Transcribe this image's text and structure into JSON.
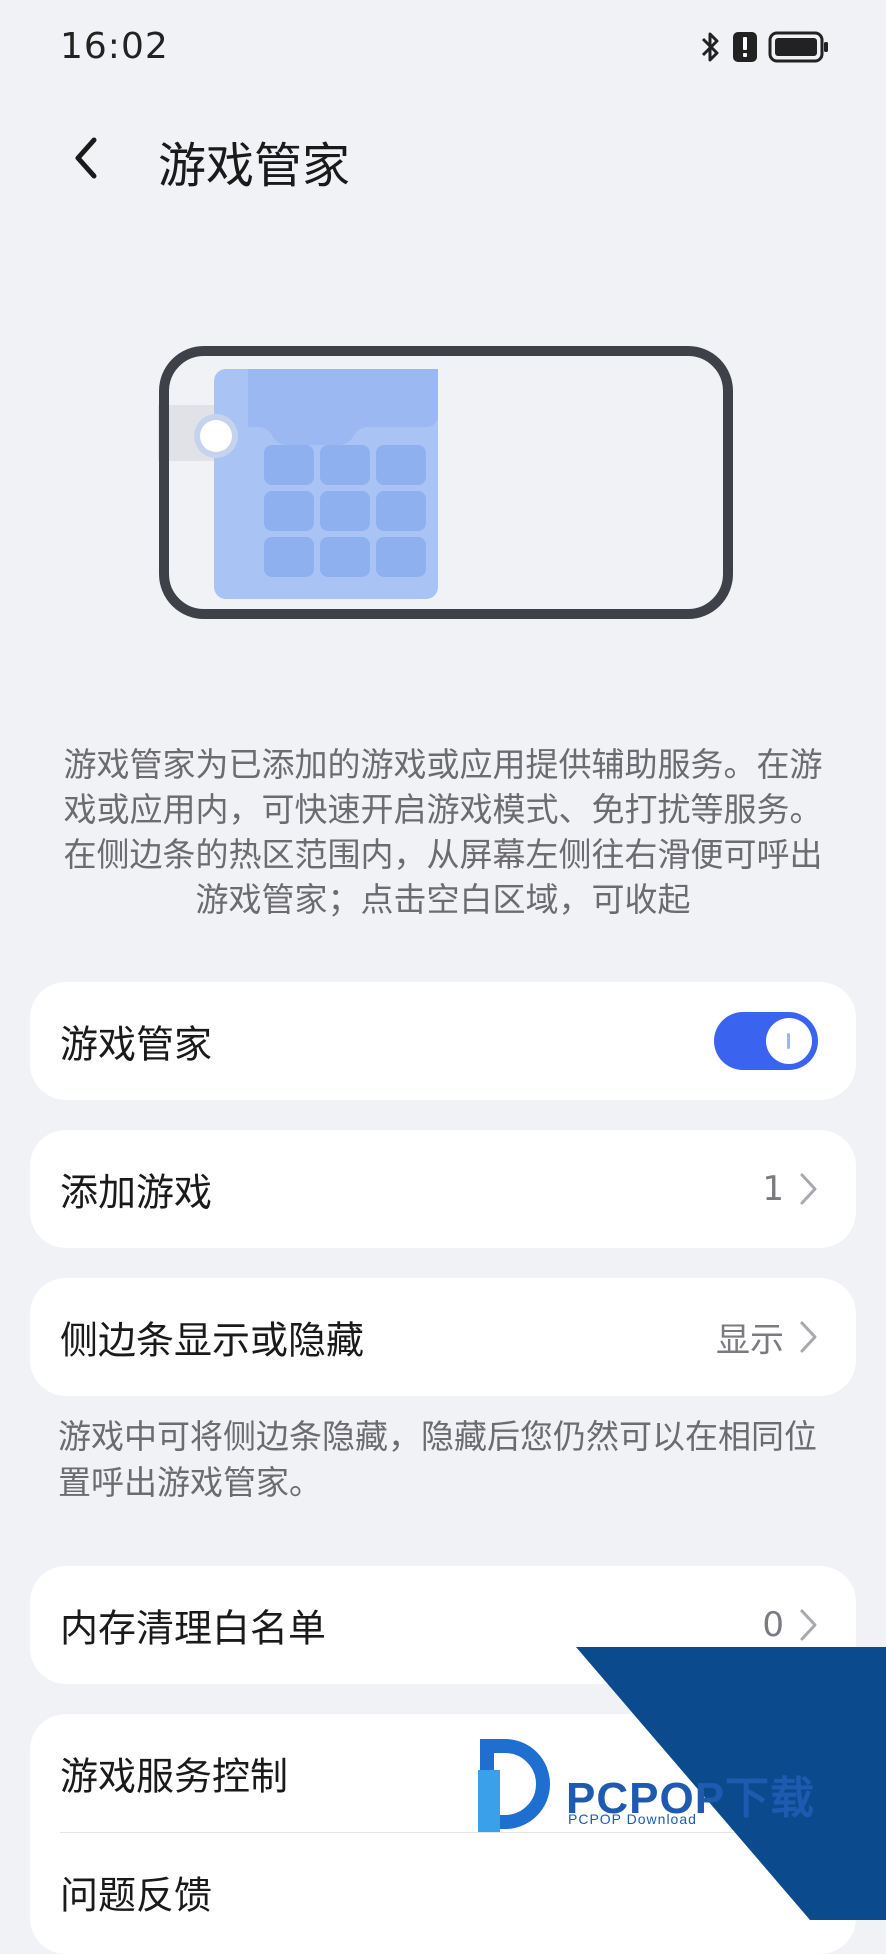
{
  "status_bar": {
    "time": "16:02",
    "icons": [
      "bluetooth-icon",
      "alert-icon",
      "battery-icon"
    ]
  },
  "header": {
    "back_icon": "chevron-left-icon",
    "title": "游戏管家"
  },
  "description": "游戏管家为已添加的游戏或应用提供辅助服务。在游戏或应用内，可快速开启游戏模式、免打扰等服务。在侧边条的热区范围内，从屏幕左侧往右滑便可呼出游戏管家；点击空白区域，可收起",
  "settings": {
    "game_manager": {
      "label": "游戏管家",
      "toggle_on": true
    },
    "add_game": {
      "label": "添加游戏",
      "value": "1"
    },
    "sidebar_visibility": {
      "label": "侧边条显示或隐藏",
      "value": "显示"
    },
    "sidebar_hint": "游戏中可将侧边条隐藏，隐藏后您仍然可以在相同位置呼出游戏管家。",
    "memory_whitelist": {
      "label": "内存清理白名单",
      "value": "0"
    },
    "game_service_control": {
      "label": "游戏服务控制"
    },
    "feedback": {
      "label": "问题反馈"
    }
  },
  "watermark": {
    "brand": "PCPOP下载",
    "sub": "PCPOP Download"
  },
  "colors": {
    "accent": "#3a64f0",
    "background": "#f1f2f6",
    "watermark_blue": "#0b4a8c"
  }
}
